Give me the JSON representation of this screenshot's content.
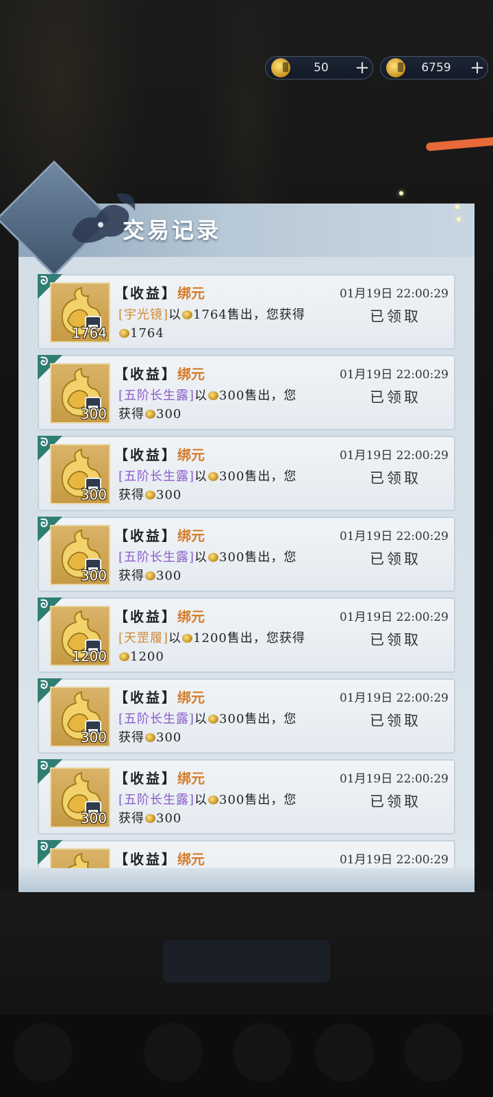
{
  "currencies": [
    {
      "icon": "gold-ingot-icon",
      "amount": "50"
    },
    {
      "icon": "bound-gold-icon",
      "amount": "6759"
    }
  ],
  "panel": {
    "title": "交易记录"
  },
  "records": [
    {
      "corner": "ᘐ",
      "qty": "1764",
      "open": "【",
      "type": "收益",
      "close": "】",
      "bind": "绑元",
      "date": "01月19日 22:00:29",
      "item": "[宇光镜]",
      "item_color": "orange",
      "pre": "以",
      "price": "1764",
      "mid": "售出，您获得",
      "gain": "1764",
      "status": "已领取"
    },
    {
      "corner": "ᘐ",
      "qty": "300",
      "open": "【",
      "type": "收益",
      "close": "】",
      "bind": "绑元",
      "date": "01月19日 22:00:29",
      "item": "[五阶长生露]",
      "item_color": "purple",
      "pre": "以",
      "price": "300",
      "mid": "售出，您获得",
      "gain": "300",
      "status": "已领取"
    },
    {
      "corner": "ᘐ",
      "qty": "300",
      "open": "【",
      "type": "收益",
      "close": "】",
      "bind": "绑元",
      "date": "01月19日 22:00:29",
      "item": "[五阶长生露]",
      "item_color": "purple",
      "pre": "以",
      "price": "300",
      "mid": "售出，您获得",
      "gain": "300",
      "status": "已领取"
    },
    {
      "corner": "ᘐ",
      "qty": "300",
      "open": "【",
      "type": "收益",
      "close": "】",
      "bind": "绑元",
      "date": "01月19日 22:00:29",
      "item": "[五阶长生露]",
      "item_color": "purple",
      "pre": "以",
      "price": "300",
      "mid": "售出，您获得",
      "gain": "300",
      "status": "已领取"
    },
    {
      "corner": "ᘐ",
      "qty": "1200",
      "open": "【",
      "type": "收益",
      "close": "】",
      "bind": "绑元",
      "date": "01月19日 22:00:29",
      "item": "[天罡履]",
      "item_color": "orange",
      "pre": "以",
      "price": "1200",
      "mid": "售出，您获得",
      "gain": "1200",
      "status": "已领取"
    },
    {
      "corner": "ᘐ",
      "qty": "300",
      "open": "【",
      "type": "收益",
      "close": "】",
      "bind": "绑元",
      "date": "01月19日 22:00:29",
      "item": "[五阶长生露]",
      "item_color": "purple",
      "pre": "以",
      "price": "300",
      "mid": "售出，您获得",
      "gain": "300",
      "status": "已领取"
    },
    {
      "corner": "ᘐ",
      "qty": "300",
      "open": "【",
      "type": "收益",
      "close": "】",
      "bind": "绑元",
      "date": "01月19日 22:00:29",
      "item": "[五阶长生露]",
      "item_color": "purple",
      "pre": "以",
      "price": "300",
      "mid": "售出，您获得",
      "gain": "300",
      "status": "已领取"
    },
    {
      "corner": "ᘐ",
      "qty": "",
      "open": "【",
      "type": "收益",
      "close": "】",
      "bind": "绑元",
      "date": "01月19日 22:00:29",
      "item": "",
      "item_color": "orange",
      "pre": "",
      "price": "",
      "mid": "",
      "gain": "",
      "status": ""
    }
  ],
  "colors": {
    "bind": "#d57b28",
    "orange_item": "#cf8a34",
    "purple_item": "#8a5ccc"
  }
}
